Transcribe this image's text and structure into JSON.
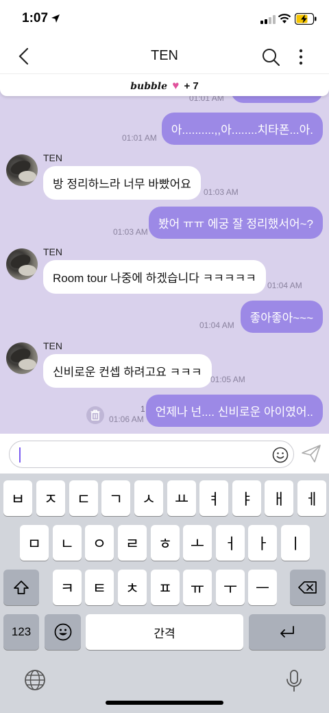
{
  "status": {
    "time": "1:07"
  },
  "header": {
    "title": "TEN"
  },
  "banner": {
    "brand": "bubble",
    "heart": "♥",
    "extra": "+ 7"
  },
  "chat": {
    "partial_ts": "01:01 AM",
    "messages": [
      {
        "dir": "out",
        "text": "아..........,,아........치타폰...아.",
        "time": "01:01 AM"
      },
      {
        "dir": "in",
        "sender": "TEN",
        "text": "방 정리하느라 너무 바빴어요",
        "time": "01:03 AM"
      },
      {
        "dir": "out",
        "text": "봤어 ㅠㅠ 에궁 잘 정리했서어~?",
        "time": "01:03 AM"
      },
      {
        "dir": "in",
        "sender": "TEN",
        "text": "Room tour 나중에 하겠습니다 ㅋㅋㅋㅋㅋ",
        "time": "01:04 AM"
      },
      {
        "dir": "out",
        "text": "좋아좋아~~~",
        "time": "01:04 AM"
      },
      {
        "dir": "in",
        "sender": "TEN",
        "text": "신비로운 컨셉 하려고요 ㅋㅋㅋ",
        "time": "01:05 AM"
      },
      {
        "dir": "out",
        "text": "언제나 넌.... 신비로운 아이였어..",
        "time": "01:06 AM",
        "unread": "1"
      }
    ]
  },
  "input": {
    "value": ""
  },
  "keyboard": {
    "row1": [
      "ㅂ",
      "ㅈ",
      "ㄷ",
      "ㄱ",
      "ㅅ",
      "ㅛ",
      "ㅕ",
      "ㅑ",
      "ㅐ",
      "ㅔ"
    ],
    "row2": [
      "ㅁ",
      "ㄴ",
      "ㅇ",
      "ㄹ",
      "ㅎ",
      "ㅗ",
      "ㅓ",
      "ㅏ",
      "ㅣ"
    ],
    "row3": [
      "ㅋ",
      "ㅌ",
      "ㅊ",
      "ㅍ",
      "ㅠ",
      "ㅜ",
      "ㅡ"
    ],
    "numbers_label": "123",
    "space_label": "간격"
  }
}
